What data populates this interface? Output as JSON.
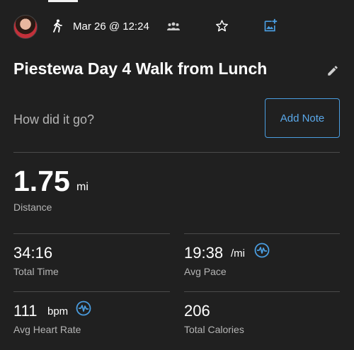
{
  "header": {
    "date": "Mar 26 @ 12:24",
    "icons": [
      "avatar",
      "walk-icon",
      "group-icon",
      "star-icon",
      "add-photo-icon"
    ]
  },
  "activity": {
    "title": "Piestewa Day 4 Walk from Lunch"
  },
  "note": {
    "prompt": "How did it go?",
    "button_label": "Add Note"
  },
  "distance": {
    "value": "1.75",
    "unit": "mi",
    "label": "Distance"
  },
  "stats": {
    "total_time": {
      "value": "34:16",
      "label": "Total Time"
    },
    "avg_pace": {
      "value": "19:38",
      "unit": "/mi",
      "label": "Avg Pace"
    },
    "avg_heart_rate": {
      "value": "111",
      "unit": "bpm",
      "label": "Avg Heart Rate"
    },
    "total_calories": {
      "value": "206",
      "label": "Total Calories"
    }
  },
  "colors": {
    "background": "#202020",
    "accent": "#4a9de0",
    "secondary_text": "#b5b5b5"
  }
}
